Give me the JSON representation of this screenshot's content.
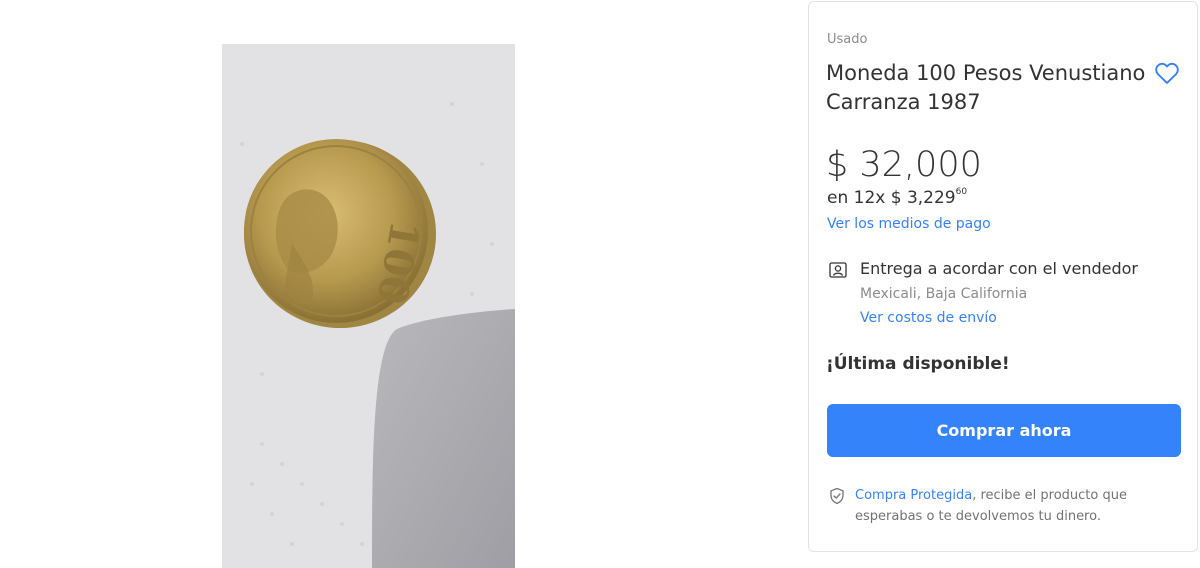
{
  "product": {
    "condition": "Usado",
    "title": "Moneda 100 Pesos Venustiano Carranza 1987",
    "price": "$ 32,000",
    "installments_prefix": "en 12x $ 3,229",
    "installments_cents": "60",
    "payment_link": "Ver los medios de pago",
    "favorite_icon": "heart-icon"
  },
  "delivery": {
    "icon": "user-card-icon",
    "title": "Entrega a acordar con el vendedor",
    "location": "Mexicali, Baja California",
    "shipping_link": "Ver costos de envío"
  },
  "stock": "¡Última disponible!",
  "buy_button": "Comprar ahora",
  "protection": {
    "icon": "shield-check-icon",
    "link": "Compra Protegida",
    "text": ", recibe el producto que esperabas o te devolvemos tu dinero."
  },
  "colors": {
    "accent": "#3483fa",
    "text": "#333333",
    "muted": "#8c8c8c"
  }
}
